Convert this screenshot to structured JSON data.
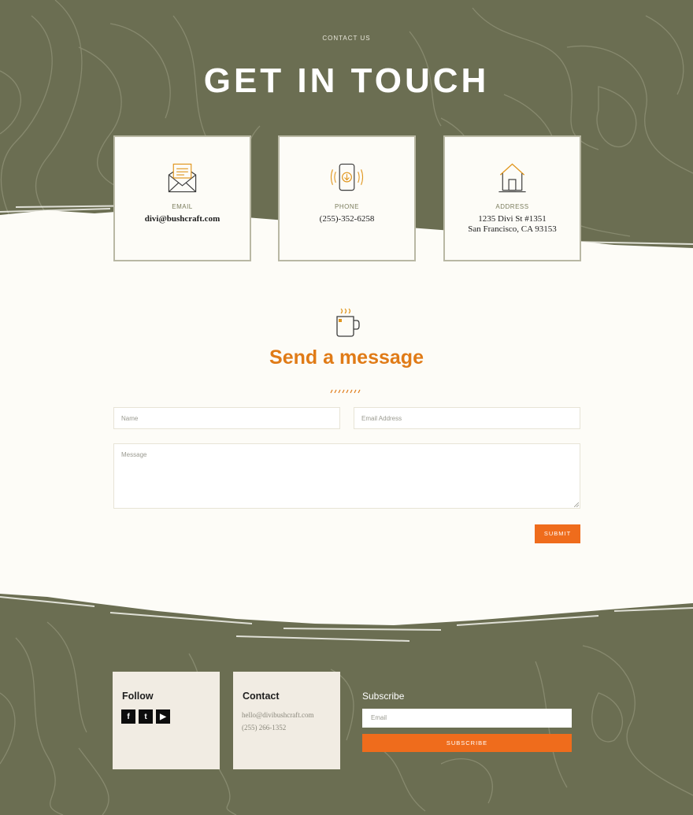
{
  "header": {
    "eyebrow": "CONTACT US",
    "title": "GET IN TOUCH"
  },
  "cards": [
    {
      "icon": "envelope-icon",
      "label": "Email",
      "lines": [
        "divi@bushcraft.com"
      ]
    },
    {
      "icon": "phone-icon",
      "label": "PHONE",
      "lines": [
        "(255)-352-6258"
      ]
    },
    {
      "icon": "house-icon",
      "label": "ADDRESS",
      "lines": [
        "1235 Divi St #1351",
        "San Francisco, CA 93153"
      ]
    }
  ],
  "message_section": {
    "icon": "mug-icon",
    "title": "Send a message",
    "form": {
      "name_placeholder": "Name",
      "email_placeholder": "Email Address",
      "message_placeholder": "Message",
      "submit_label": "SUBMIT"
    }
  },
  "footer": {
    "follow": {
      "heading": "Follow",
      "social": [
        {
          "icon": "facebook-icon",
          "glyph": "f"
        },
        {
          "icon": "twitter-icon",
          "glyph": "t"
        },
        {
          "icon": "youtube-icon",
          "glyph": "▶"
        }
      ]
    },
    "contact": {
      "heading": "Contact",
      "email": "hello@divibushcraft.com",
      "phone": "(255) 266-1352"
    },
    "subscribe": {
      "heading": "Subscribe",
      "email_placeholder": "Email",
      "button_label": "SUBSCRIBE"
    }
  },
  "colors": {
    "olive": "#6b6e52",
    "cream": "#fdfcf7",
    "accent": "#ef6c1c",
    "title_orange": "#e07b17"
  }
}
